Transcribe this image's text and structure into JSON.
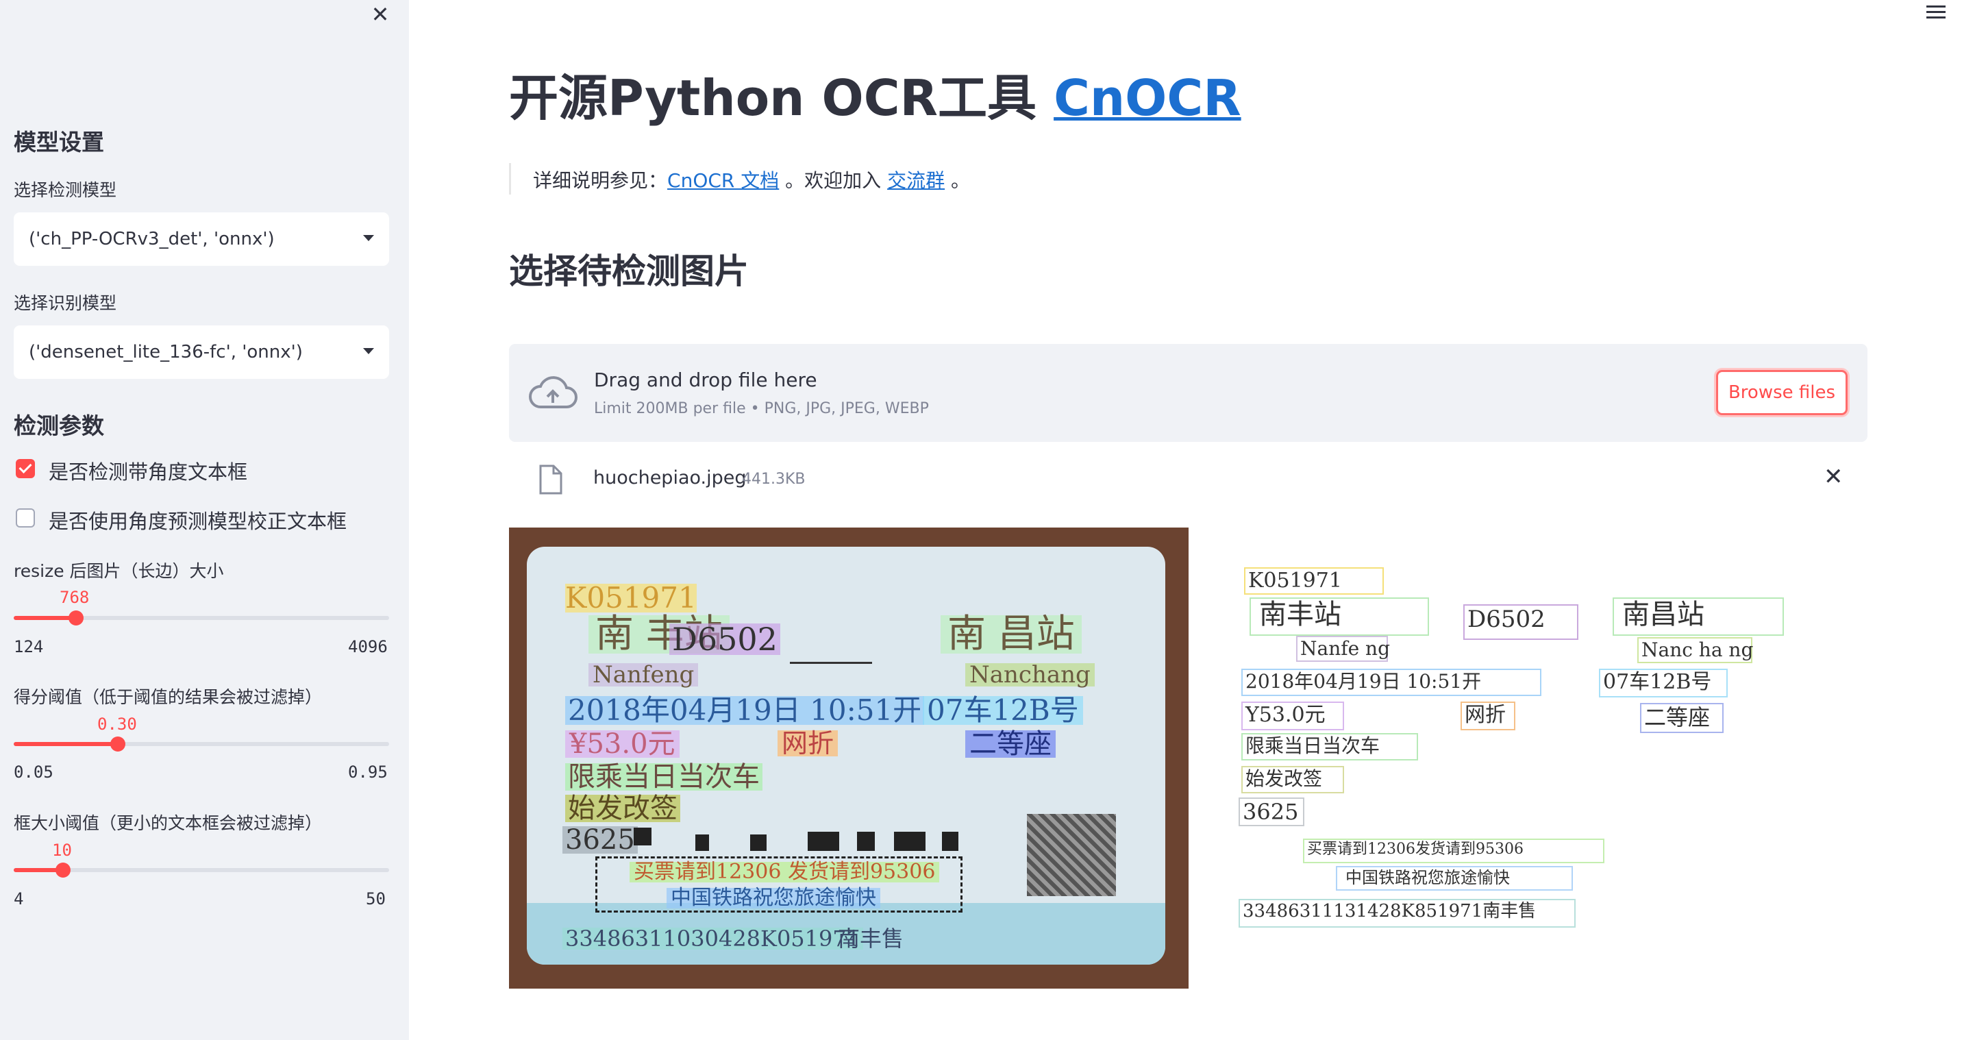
{
  "sidebar": {
    "close_icon": "close-icon",
    "model_settings_title": "模型设置",
    "det_model_label": "选择检测模型",
    "det_model_value": "('ch_PP-OCRv3_det', 'onnx')",
    "rec_model_label": "选择识别模型",
    "rec_model_value": "('densenet_lite_136-fc', 'onnx')",
    "det_params_title": "检测参数",
    "checkbox_rotated": {
      "label": "是否检测带角度文本框",
      "checked": true
    },
    "checkbox_angle_clf": {
      "label": "是否使用角度预测模型校正文本框",
      "checked": false
    },
    "resize_slider": {
      "label": "resize 后图片（长边）大小",
      "value": "768",
      "min": "124",
      "max": "4096"
    },
    "score_slider": {
      "label": "得分阈值（低于阈值的结果会被过滤掉）",
      "value": "0.30",
      "min": "0.05",
      "max": "0.95"
    },
    "box_slider": {
      "label": "框大小阈值（更小的文本框会被过滤掉）",
      "value": "10",
      "min": "4",
      "max": "50"
    }
  },
  "header": {
    "menu_icon": "hamburger-menu-icon"
  },
  "main": {
    "title_prefix": "开源Python OCR工具 ",
    "title_link": "CnOCR",
    "info_prefix": "详细说明参见：",
    "info_link1": "CnOCR 文档",
    "info_mid": " 。欢迎加入 ",
    "info_link2": "交流群",
    "info_suffix": " 。",
    "section_title": "选择待检测图片",
    "uploader": {
      "drag_text": "Drag and drop file here",
      "limit_text": "Limit 200MB per file • PNG, JPG, JPEG, WEBP",
      "browse_label": "Browse files"
    },
    "file": {
      "name": "huochepiao.jpeg",
      "size": "441.3KB"
    },
    "ticket_text": {
      "code": "K051971",
      "from_station": "南  丰站",
      "train": "D6502",
      "to_station": "南  昌站",
      "from_pinyin": "Nanfeng",
      "to_pinyin": "Nanchang",
      "date": "2018年04月19日 10:51开",
      "seat": "07车12B号",
      "price": "¥53.0元",
      "discount": "网折",
      "seat_class": "二等座",
      "restriction": "限乘当日当次车",
      "change": "始发改签",
      "id_prefix": "3625",
      "notice1": "买票请到12306 发货请到95306",
      "notice2": "中国铁路祝您旅途愉快",
      "serial": "33486311030428K051971",
      "seller": "南丰售"
    },
    "ocr_results": {
      "code": "K051971",
      "from_station": "南丰站",
      "train": "D6502",
      "to_station": "南昌站",
      "from_pinyin": "Nanfe ng",
      "to_pinyin": "Nanc ha ng",
      "date": "2018年04月19日 10:51开",
      "seat": "07车12B号",
      "price": "Y53.0元",
      "discount": "网折",
      "seat_class": "二等座",
      "restriction": "限乘当日当次车",
      "change": "始发改签",
      "id_prefix": "3625",
      "notice1": "买票请到12306发货请到95306",
      "notice2": "中国铁路祝您旅途愉快",
      "serial": "33486311131428K851971南丰售"
    }
  }
}
